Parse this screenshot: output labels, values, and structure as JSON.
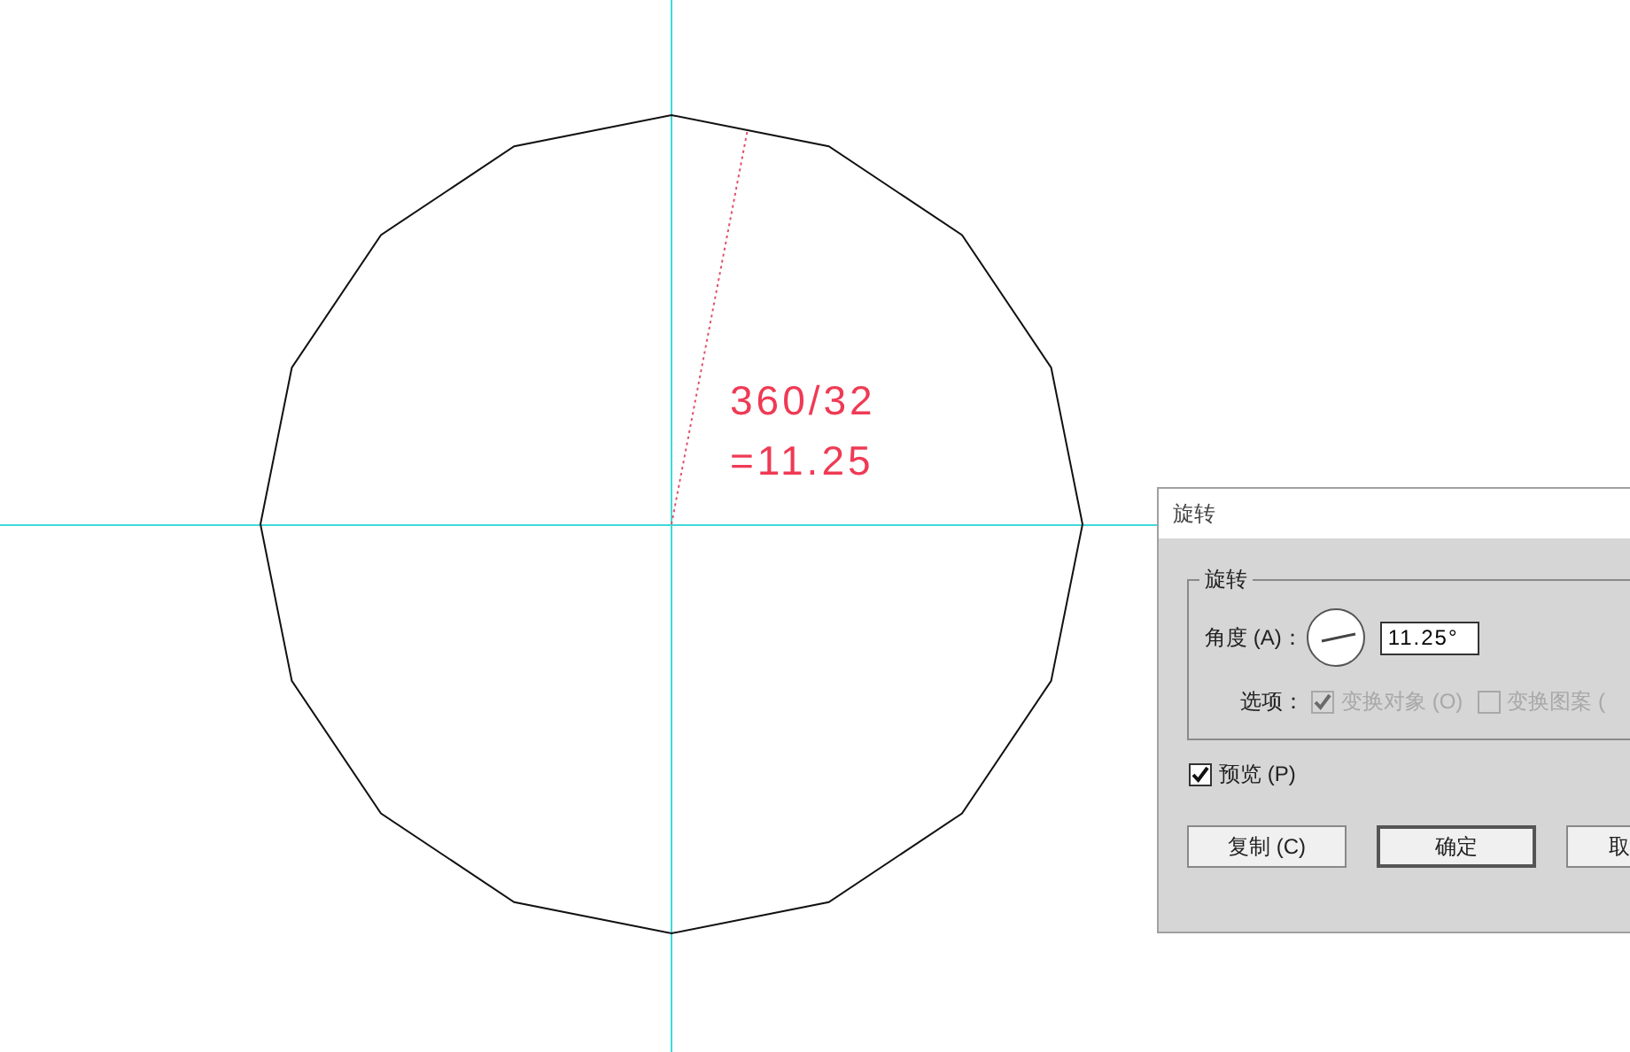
{
  "canvas": {
    "annotation": [
      "360/32",
      "=11.25"
    ]
  },
  "dialog": {
    "title": "旋转",
    "group_title": "旋转",
    "angle_label": "角度 (A)：",
    "angle_value": "11.25°",
    "options_label": "选项：",
    "options": [
      {
        "label": "变换对象 (O)",
        "checked": true,
        "disabled": true
      },
      {
        "label": "变换图案 (",
        "checked": false,
        "disabled": true
      }
    ],
    "preview": {
      "label": "预览 (P)",
      "checked": true
    },
    "buttons": [
      {
        "label": "复制 (C)",
        "default": false
      },
      {
        "label": "确定",
        "default": true
      },
      {
        "label": "取",
        "default": false
      }
    ]
  }
}
